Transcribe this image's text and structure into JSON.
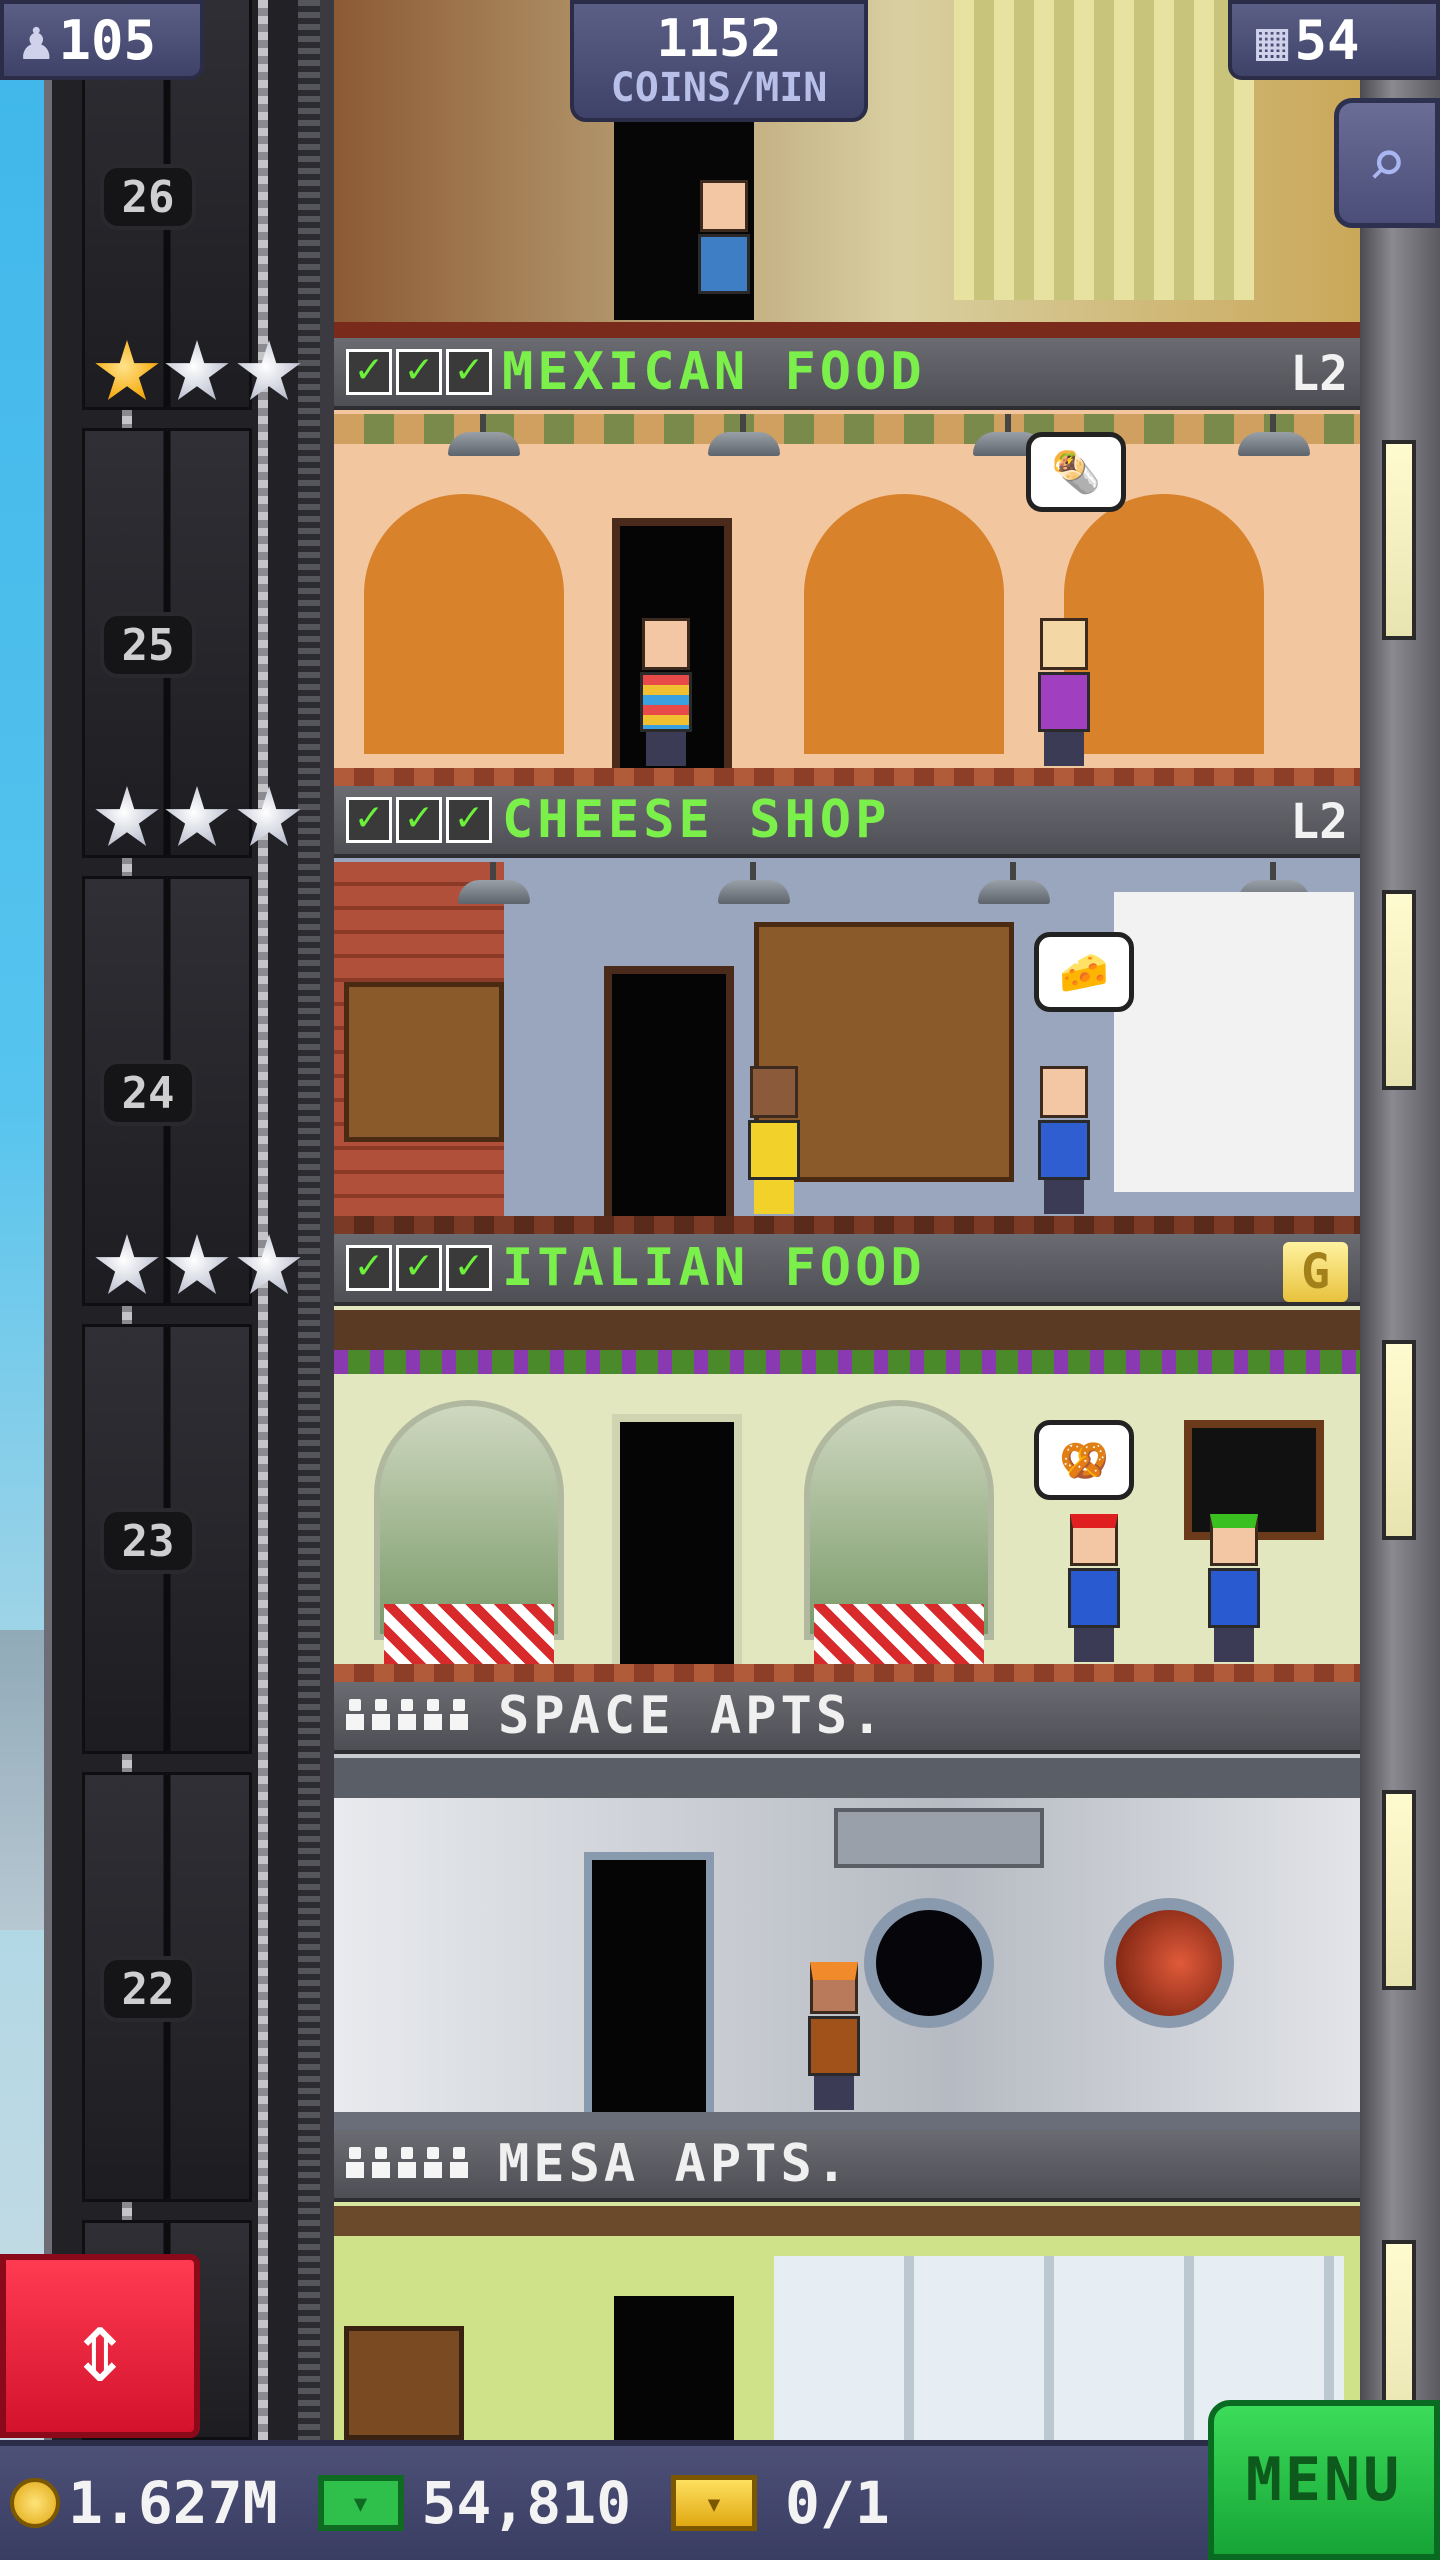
{
  "top": {
    "population": "105",
    "coins_per_min_value": "1152",
    "coins_per_min_label": "COINS/MIN",
    "floors_count": "54"
  },
  "floor_numbers": [
    "26",
    "25",
    "24",
    "23",
    "22"
  ],
  "floors": [
    {
      "name": "MEXICAN FOOD",
      "level": "L2",
      "type": "food",
      "stars": [
        "gold",
        "silver",
        "silver"
      ],
      "checks": 3,
      "bubble_icon": "burrito-icon"
    },
    {
      "name": "CHEESE SHOP",
      "level": "L2",
      "type": "retail",
      "stars": [
        "silver",
        "silver",
        "silver"
      ],
      "checks": 3,
      "bubble_icon": "cheese-icon"
    },
    {
      "name": "ITALIAN FOOD",
      "level": "G",
      "type": "food",
      "stars": [
        "silver",
        "silver",
        "silver"
      ],
      "checks": 3,
      "bubble_icon": "pretzel-icon"
    },
    {
      "name": "SPACE APTS.",
      "type": "residential",
      "residents": 5
    },
    {
      "name": "MESA APTS.",
      "type": "residential",
      "residents": 5
    }
  ],
  "bottom_bar": {
    "coins": "1.627M",
    "bux": "54,810",
    "tickets": "0/1",
    "menu_label": "MENU"
  },
  "colors": {
    "label_green": "#7cf04a",
    "badge_blue": "#4b4e78",
    "menu_green": "#22b844",
    "elevator_red": "#e81e38"
  }
}
